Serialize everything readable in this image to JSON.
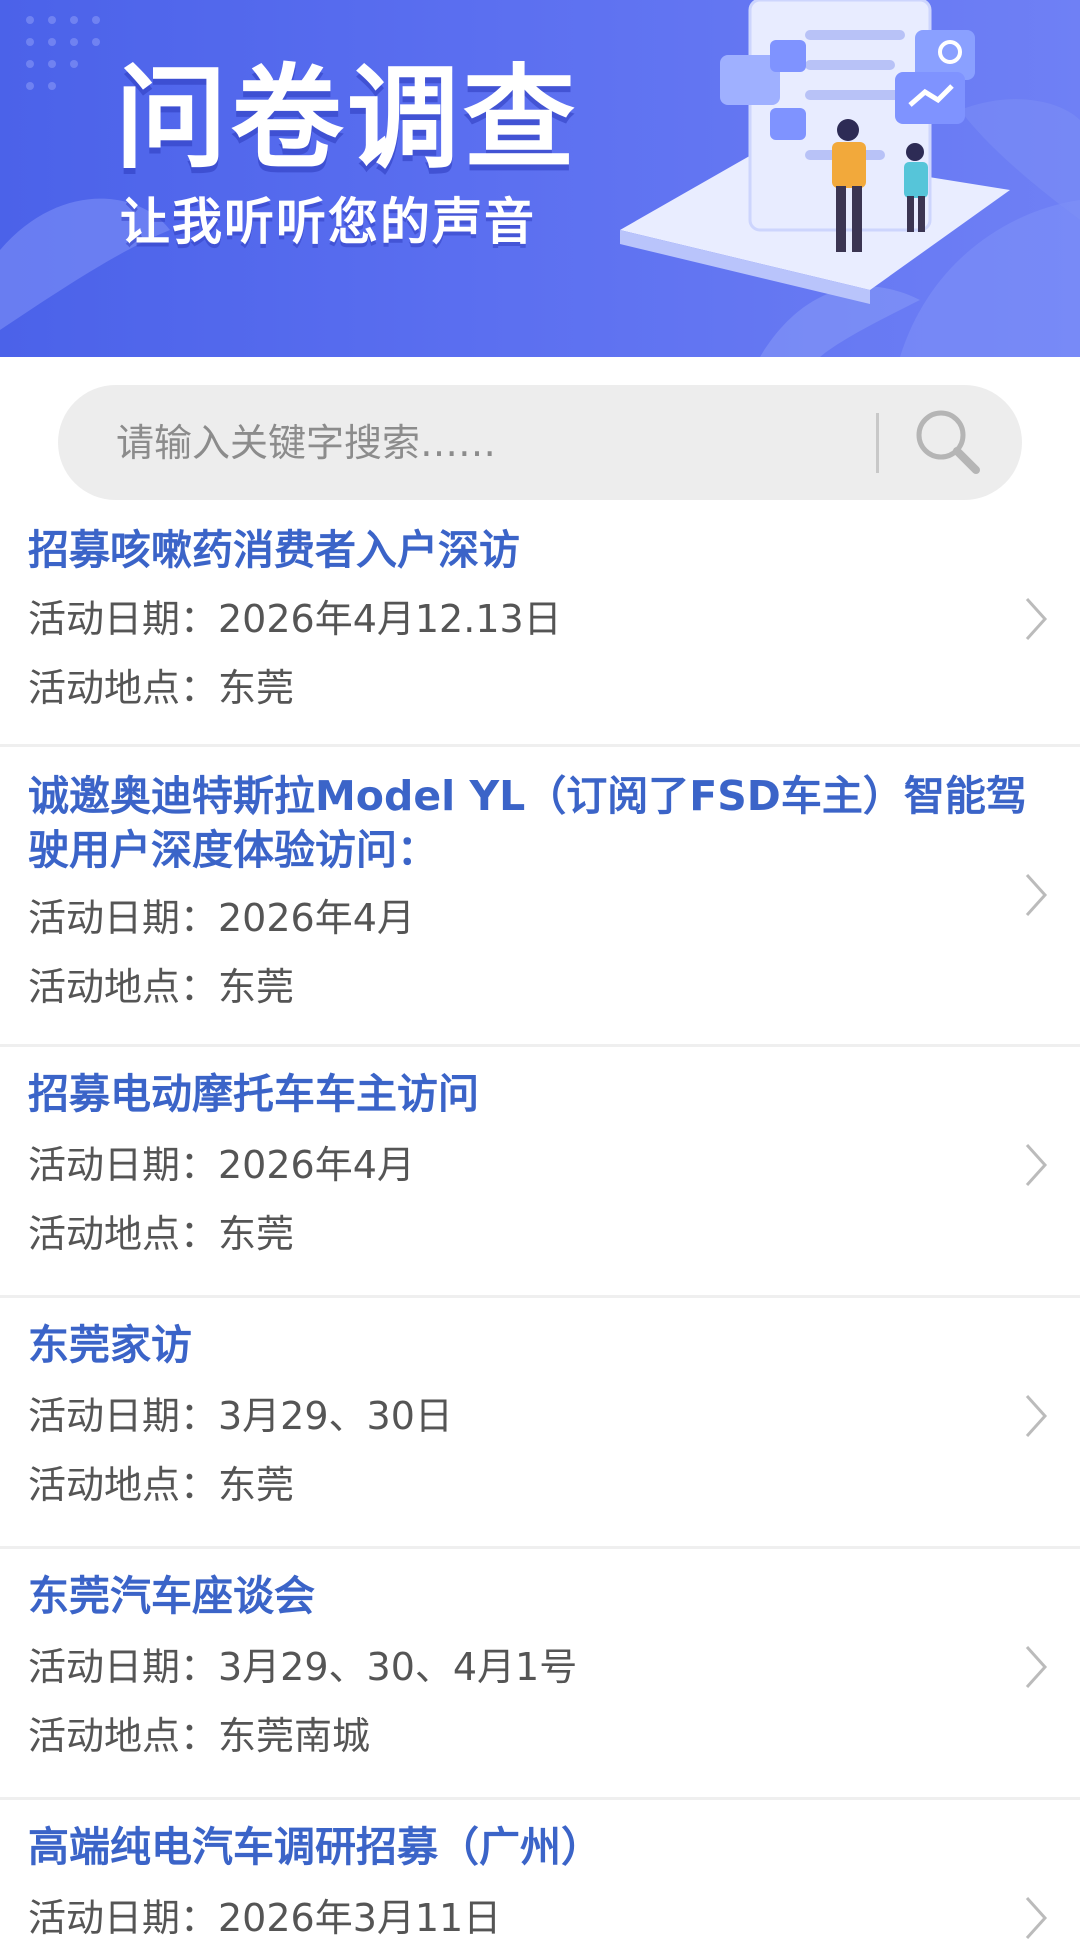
{
  "banner": {
    "title": "问卷调查",
    "subtitle": "让我听听您的声音"
  },
  "search": {
    "placeholder": "请输入关键字搜索……"
  },
  "activities": [
    {
      "title": "招募咳嗽药消费者入户深访",
      "date": "活动日期：2026年4月12.13日",
      "location": "活动地点：东莞"
    },
    {
      "title": "诚邀奥迪特斯拉Model YL（订阅了FSD车主）智能驾驶用户深度体验访问：",
      "date": "活动日期：2026年4月",
      "location": "活动地点：东莞"
    },
    {
      "title": "招募电动摩托车车主访问",
      "date": "活动日期：2026年4月",
      "location": "活动地点：东莞"
    },
    {
      "title": "东莞家访",
      "date": "活动日期：3月29、30日",
      "location": "活动地点：东莞"
    },
    {
      "title": "东莞汽车座谈会",
      "date": "活动日期：3月29、30、4月1号",
      "location": "活动地点：东莞南城"
    },
    {
      "title": "高端纯电汽车调研招募（广州）",
      "date": "活动日期：2026年3月11日",
      "location": ""
    }
  ],
  "colors": {
    "banner": "#4b62e9",
    "title": "#3b64c8",
    "body_text": "#555555",
    "divider": "#efefef"
  }
}
